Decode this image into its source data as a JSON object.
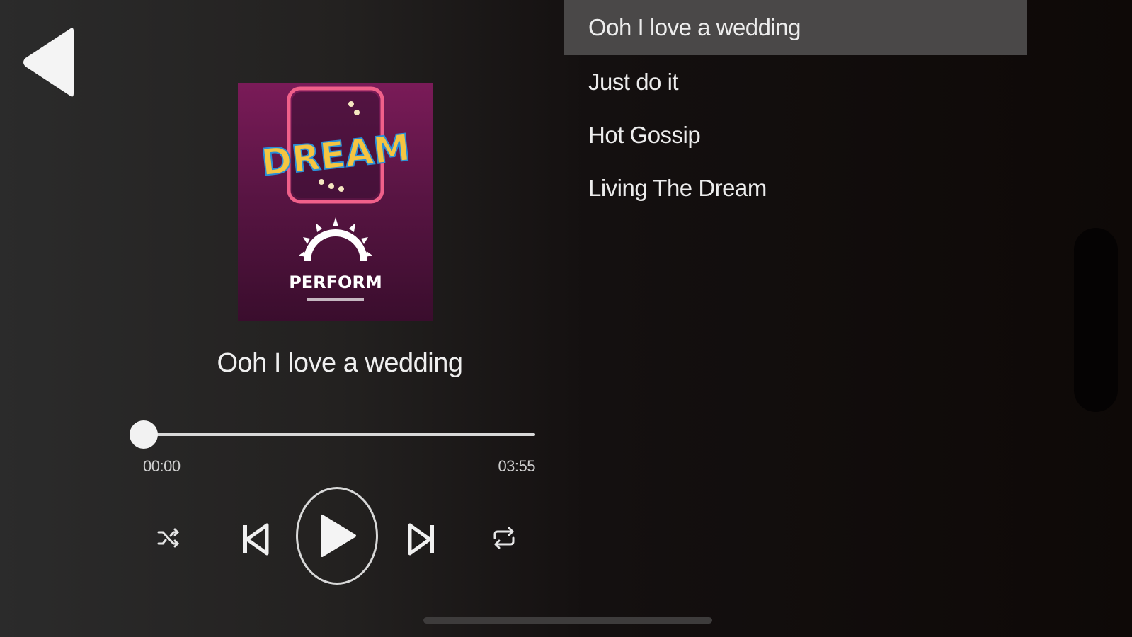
{
  "album": {
    "logo_text": "DREAM",
    "brand_text": "PERFORM"
  },
  "player": {
    "track_title": "Ooh I love a wedding",
    "current_time": "00:00",
    "total_time": "03:55",
    "progress": 0
  },
  "icons": {
    "back": "back-arrow-icon",
    "shuffle": "shuffle-icon",
    "previous": "skip-previous-icon",
    "play": "play-icon",
    "next": "skip-next-icon",
    "repeat": "repeat-icon"
  },
  "playlist": {
    "items": [
      {
        "label": "Ooh I love a wedding",
        "active": true
      },
      {
        "label": "Just do it",
        "active": false
      },
      {
        "label": "Hot Gossip",
        "active": false
      },
      {
        "label": "Living The Dream",
        "active": false
      }
    ]
  },
  "colors": {
    "album_bg": "#6b1a4f",
    "active_row": "#4a4848"
  }
}
